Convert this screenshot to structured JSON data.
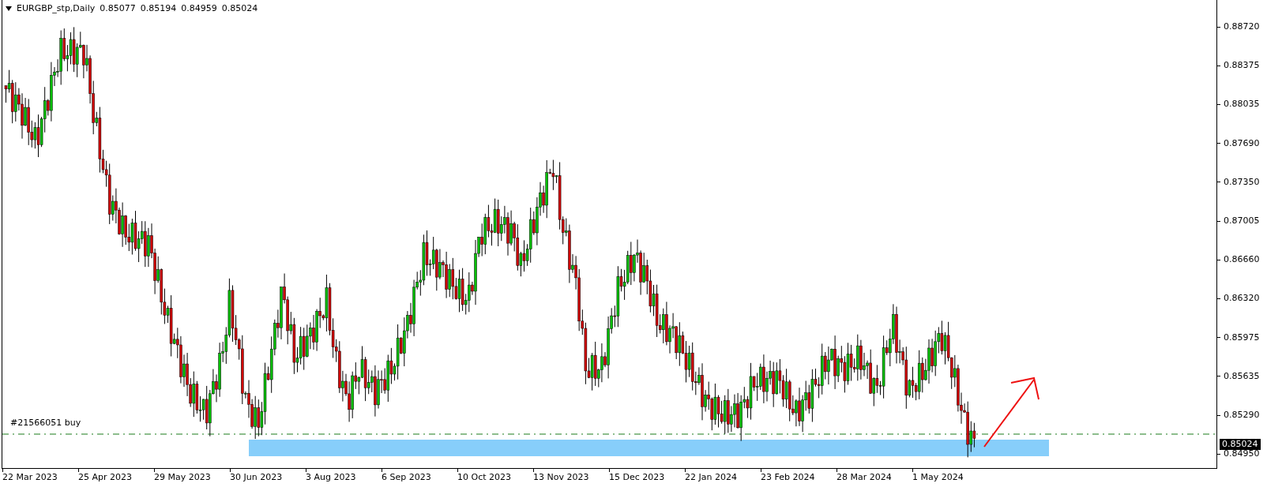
{
  "header": {
    "symbol": "EURGBP_stp,Daily",
    "open": "0.85077",
    "high": "0.85194",
    "low": "0.84959",
    "close": "0.85024"
  },
  "price_axis": {
    "ticks": [
      "0.88720",
      "0.88375",
      "0.88035",
      "0.87690",
      "0.87350",
      "0.87005",
      "0.86660",
      "0.86320",
      "0.85975",
      "0.85635",
      "0.85290",
      "0.84950"
    ],
    "current_price": "0.85024"
  },
  "time_axis": [
    "22 Mar 2023",
    "25 Apr 2023",
    "29 May 2023",
    "30 Jun 2023",
    "3 Aug 2023",
    "6 Sep 2023",
    "10 Oct 2023",
    "13 Nov 2023",
    "15 Dec 2023",
    "22 Jan 2024",
    "23 Feb 2024",
    "28 Mar 2024",
    "1 May 2024"
  ],
  "order_line": {
    "label": "#21566051 buy"
  }
}
